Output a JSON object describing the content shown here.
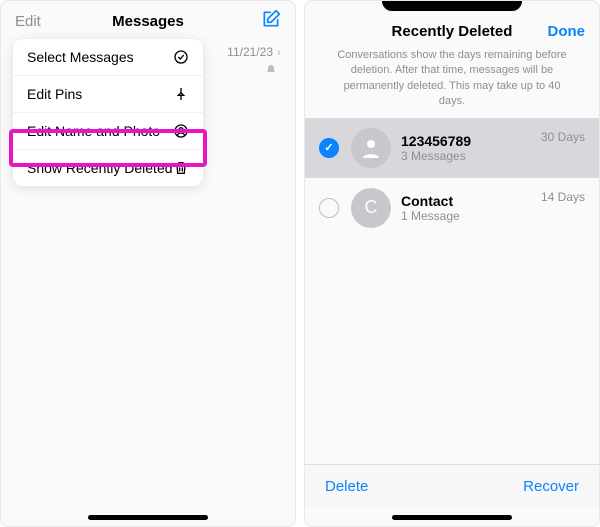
{
  "left": {
    "header": {
      "edit": "Edit",
      "title": "Messages"
    },
    "menu": {
      "items": [
        {
          "label": "Select Messages"
        },
        {
          "label": "Edit Pins"
        },
        {
          "label": "Edit Name and Photo"
        },
        {
          "label": "Show Recently Deleted"
        }
      ]
    },
    "preview": {
      "date": "11/21/23"
    }
  },
  "right": {
    "header": {
      "title": "Recently Deleted",
      "done": "Done"
    },
    "description": "Conversations show the days remaining before deletion. After that time, messages will be permanently deleted. This may take up to 40 days.",
    "items": [
      {
        "title": "123456789",
        "sub": "3 Messages",
        "days": "30 Days",
        "avatar_letter": ""
      },
      {
        "title": "Contact",
        "sub": "1 Message",
        "days": "14 Days",
        "avatar_letter": "C"
      }
    ],
    "toolbar": {
      "delete": "Delete",
      "recover": "Recover"
    }
  }
}
